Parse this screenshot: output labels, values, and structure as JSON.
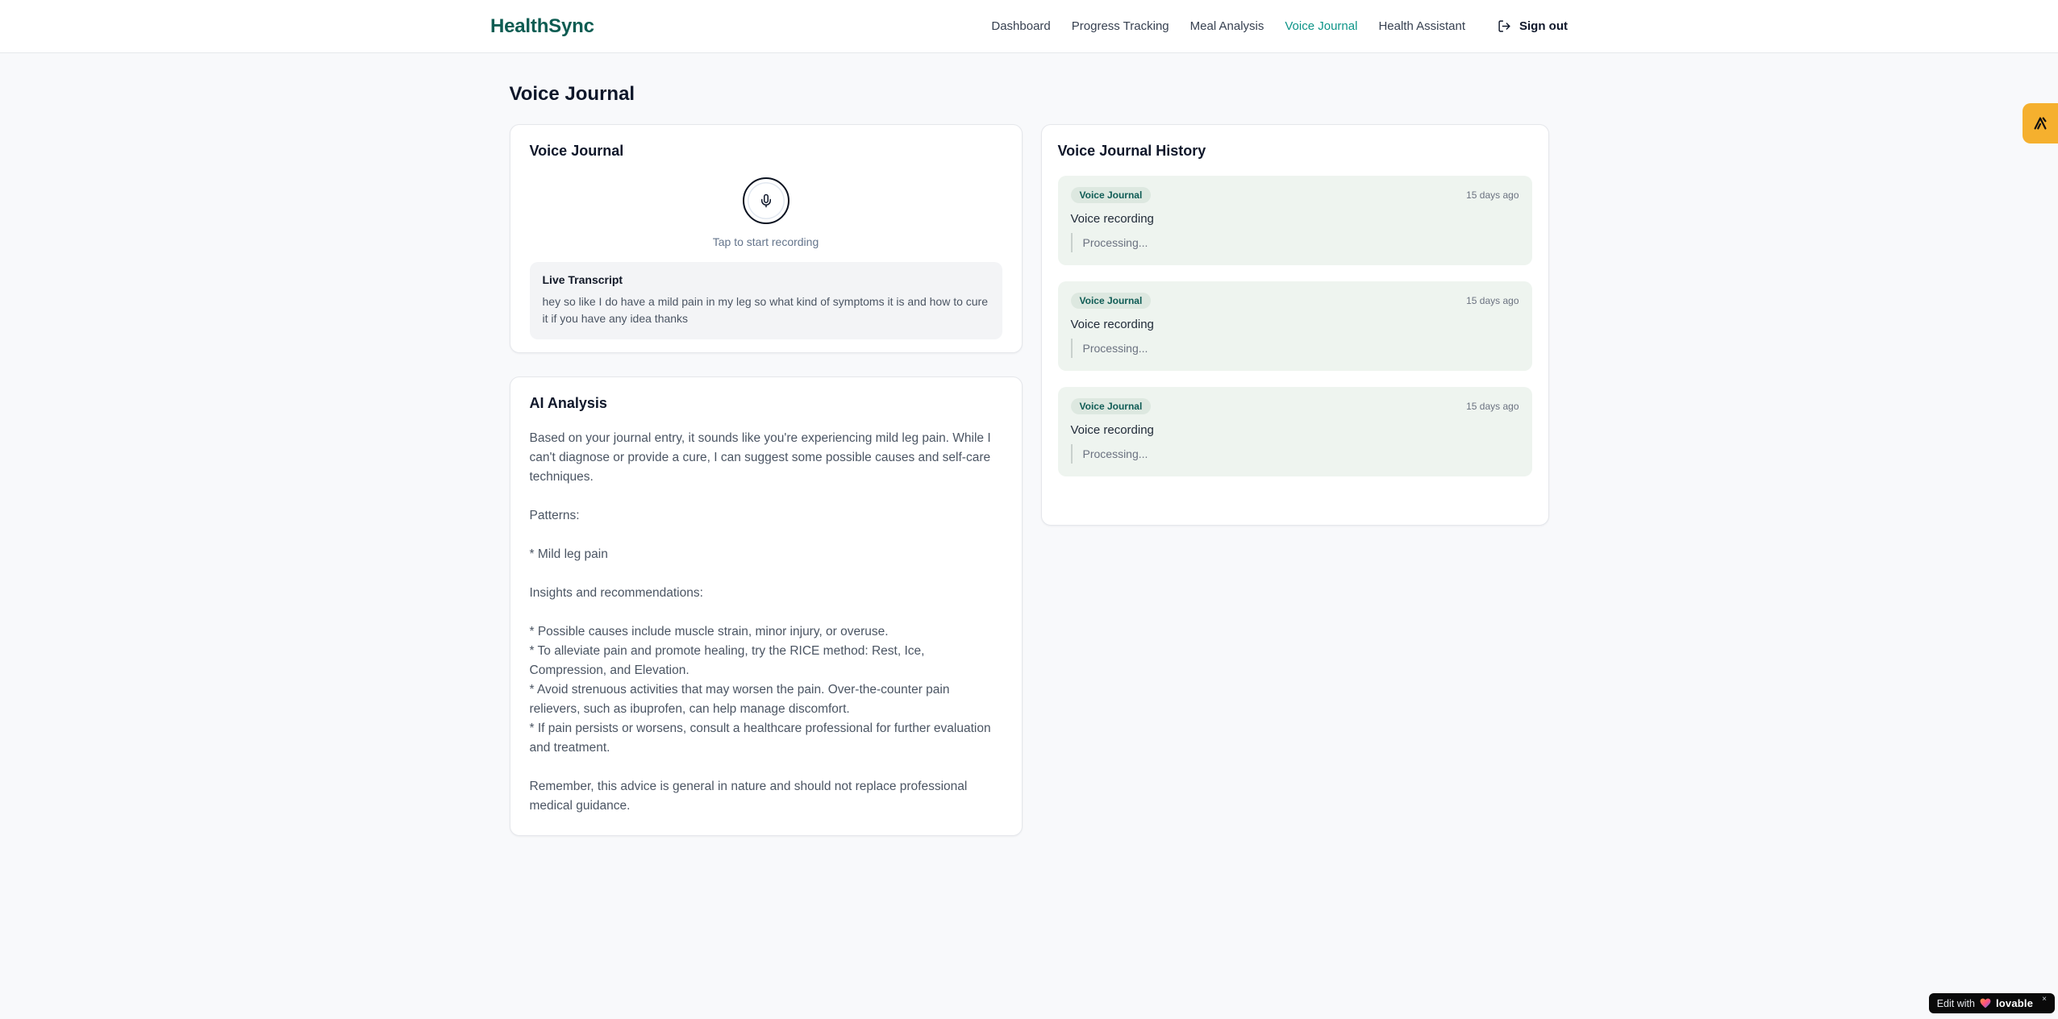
{
  "header": {
    "brand": "HealthSync",
    "nav_items": [
      "Dashboard",
      "Progress Tracking",
      "Meal Analysis",
      "Voice Journal",
      "Health Assistant"
    ],
    "active_item": "Voice Journal",
    "sign_out": "Sign out"
  },
  "page": {
    "title": "Voice Journal"
  },
  "recorder": {
    "title": "Voice Journal",
    "hint": "Tap to start recording",
    "transcript_title": "Live Transcript",
    "transcript_text": "hey so like I do have a mild pain in my leg so what kind of symptoms it is and how to cure it if you have any idea thanks"
  },
  "analysis": {
    "title": "AI Analysis",
    "body": "Based on your journal entry, it sounds like you're experiencing mild leg pain. While I can't diagnose or provide a cure, I can suggest some possible causes and self-care techniques.\n\nPatterns:\n\n* Mild leg pain\n\nInsights and recommendations:\n\n* Possible causes include muscle strain, minor injury, or overuse.\n* To alleviate pain and promote healing, try the RICE method: Rest, Ice, Compression, and Elevation.\n* Avoid strenuous activities that may worsen the pain. Over-the-counter pain relievers, such as ibuprofen, can help manage discomfort.\n* If pain persists or worsens, consult a healthcare professional for further evaluation and treatment.\n\nRemember, this advice is general in nature and should not replace professional medical guidance."
  },
  "history": {
    "title": "Voice Journal History",
    "entries": [
      {
        "badge": "Voice Journal",
        "time": "15 days ago",
        "label": "Voice recording",
        "status": "Processing..."
      },
      {
        "badge": "Voice Journal",
        "time": "15 days ago",
        "label": "Voice recording",
        "status": "Processing..."
      },
      {
        "badge": "Voice Journal",
        "time": "15 days ago",
        "label": "Voice recording",
        "status": "Processing..."
      }
    ]
  },
  "overlays": {
    "lovable_prefix": "Edit with",
    "lovable_brand": "lovable",
    "lovable_close": "×"
  },
  "colors": {
    "brand": "#0d5c52",
    "nav_active": "#0d9488",
    "entry_bg": "#eef4ef",
    "badge_bg": "#dde8e0",
    "badge_text": "#0f5c55",
    "side_button_bg": "#f5b02e",
    "lovable_bg": "#0a0a0a"
  }
}
